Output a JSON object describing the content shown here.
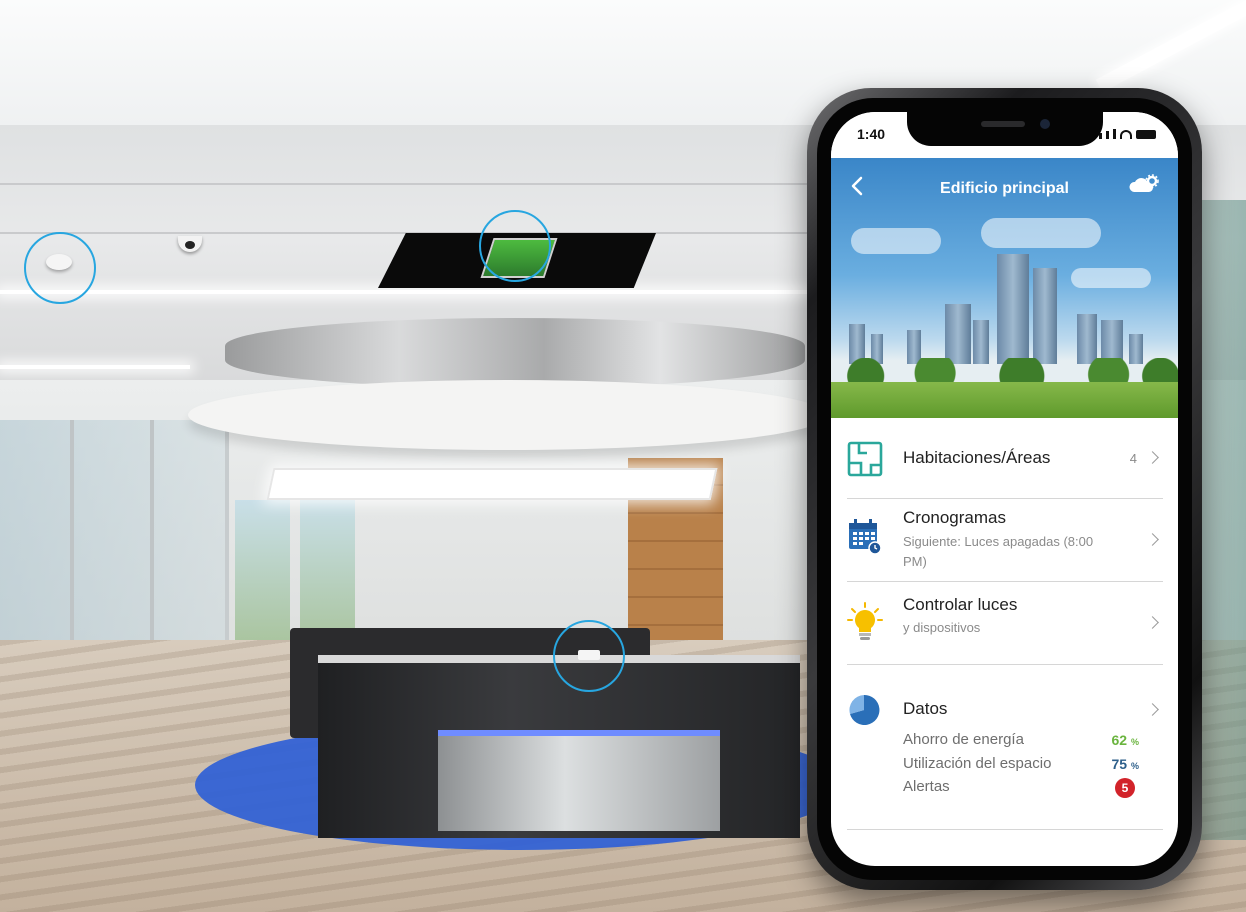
{
  "phone": {
    "status_bar": {
      "time": "1:40"
    },
    "header": {
      "title": "Edificio principal",
      "back_icon": "chevron-left-icon",
      "settings_icon": "cloud-gear-icon"
    },
    "menu": {
      "rooms": {
        "title": "Habitaciones/Áreas",
        "count": "4"
      },
      "schedules": {
        "title": "Cronogramas",
        "subtitle": "Siguiente: Luces apagadas (8:00 PM)"
      },
      "lights": {
        "title": "Controlar luces",
        "subtitle": "y dispositivos"
      },
      "data": {
        "title": "Datos",
        "energy_label": "Ahorro de energía",
        "energy_value": "62",
        "energy_unit": "%",
        "space_label": "Utilización del espacio",
        "space_value": "75",
        "space_unit": "%",
        "alerts_label": "Alertas",
        "alerts_count": "5"
      }
    }
  },
  "colors": {
    "highlight": "#27a6e0",
    "energy": "#6ab43e",
    "space": "#2d5f8a",
    "alert": "#d2232a",
    "accent": "#2a6fb8"
  }
}
